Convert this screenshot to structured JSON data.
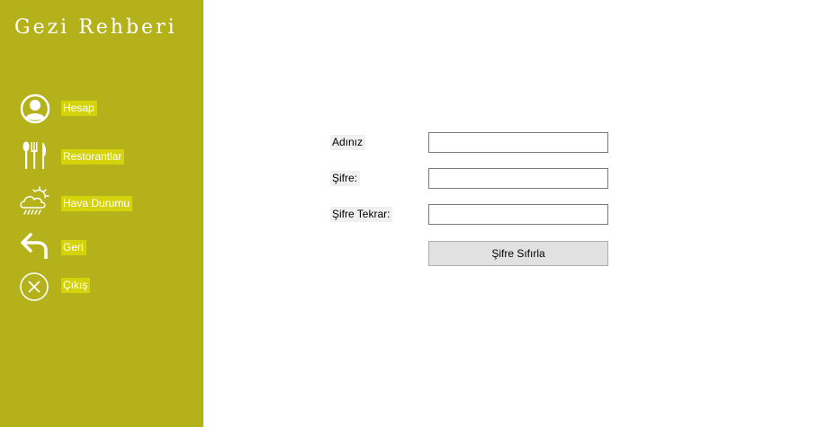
{
  "sidebar": {
    "title": "Gezi Rehberi",
    "items": [
      {
        "label": "Hesap",
        "icon": "user-circle-icon"
      },
      {
        "label": "Restorantlar",
        "icon": "cutlery-icon"
      },
      {
        "label": "Hava Durumu",
        "icon": "weather-icon"
      },
      {
        "label": "Geri",
        "icon": "back-arrow-icon"
      },
      {
        "label": "Çıkış",
        "icon": "close-circle-icon"
      }
    ]
  },
  "form": {
    "name_label": "Adınız",
    "name_value": "",
    "password_label": "Şifre:",
    "password_value": "",
    "password_repeat_label": "Şifre Tekrar:",
    "password_repeat_value": "",
    "submit_label": "Şifre Sıfırla"
  },
  "colors": {
    "sidebar_bg": "#b4b11b",
    "label_highlight": "#d4d20a",
    "button_bg": "#e1e1e1"
  }
}
